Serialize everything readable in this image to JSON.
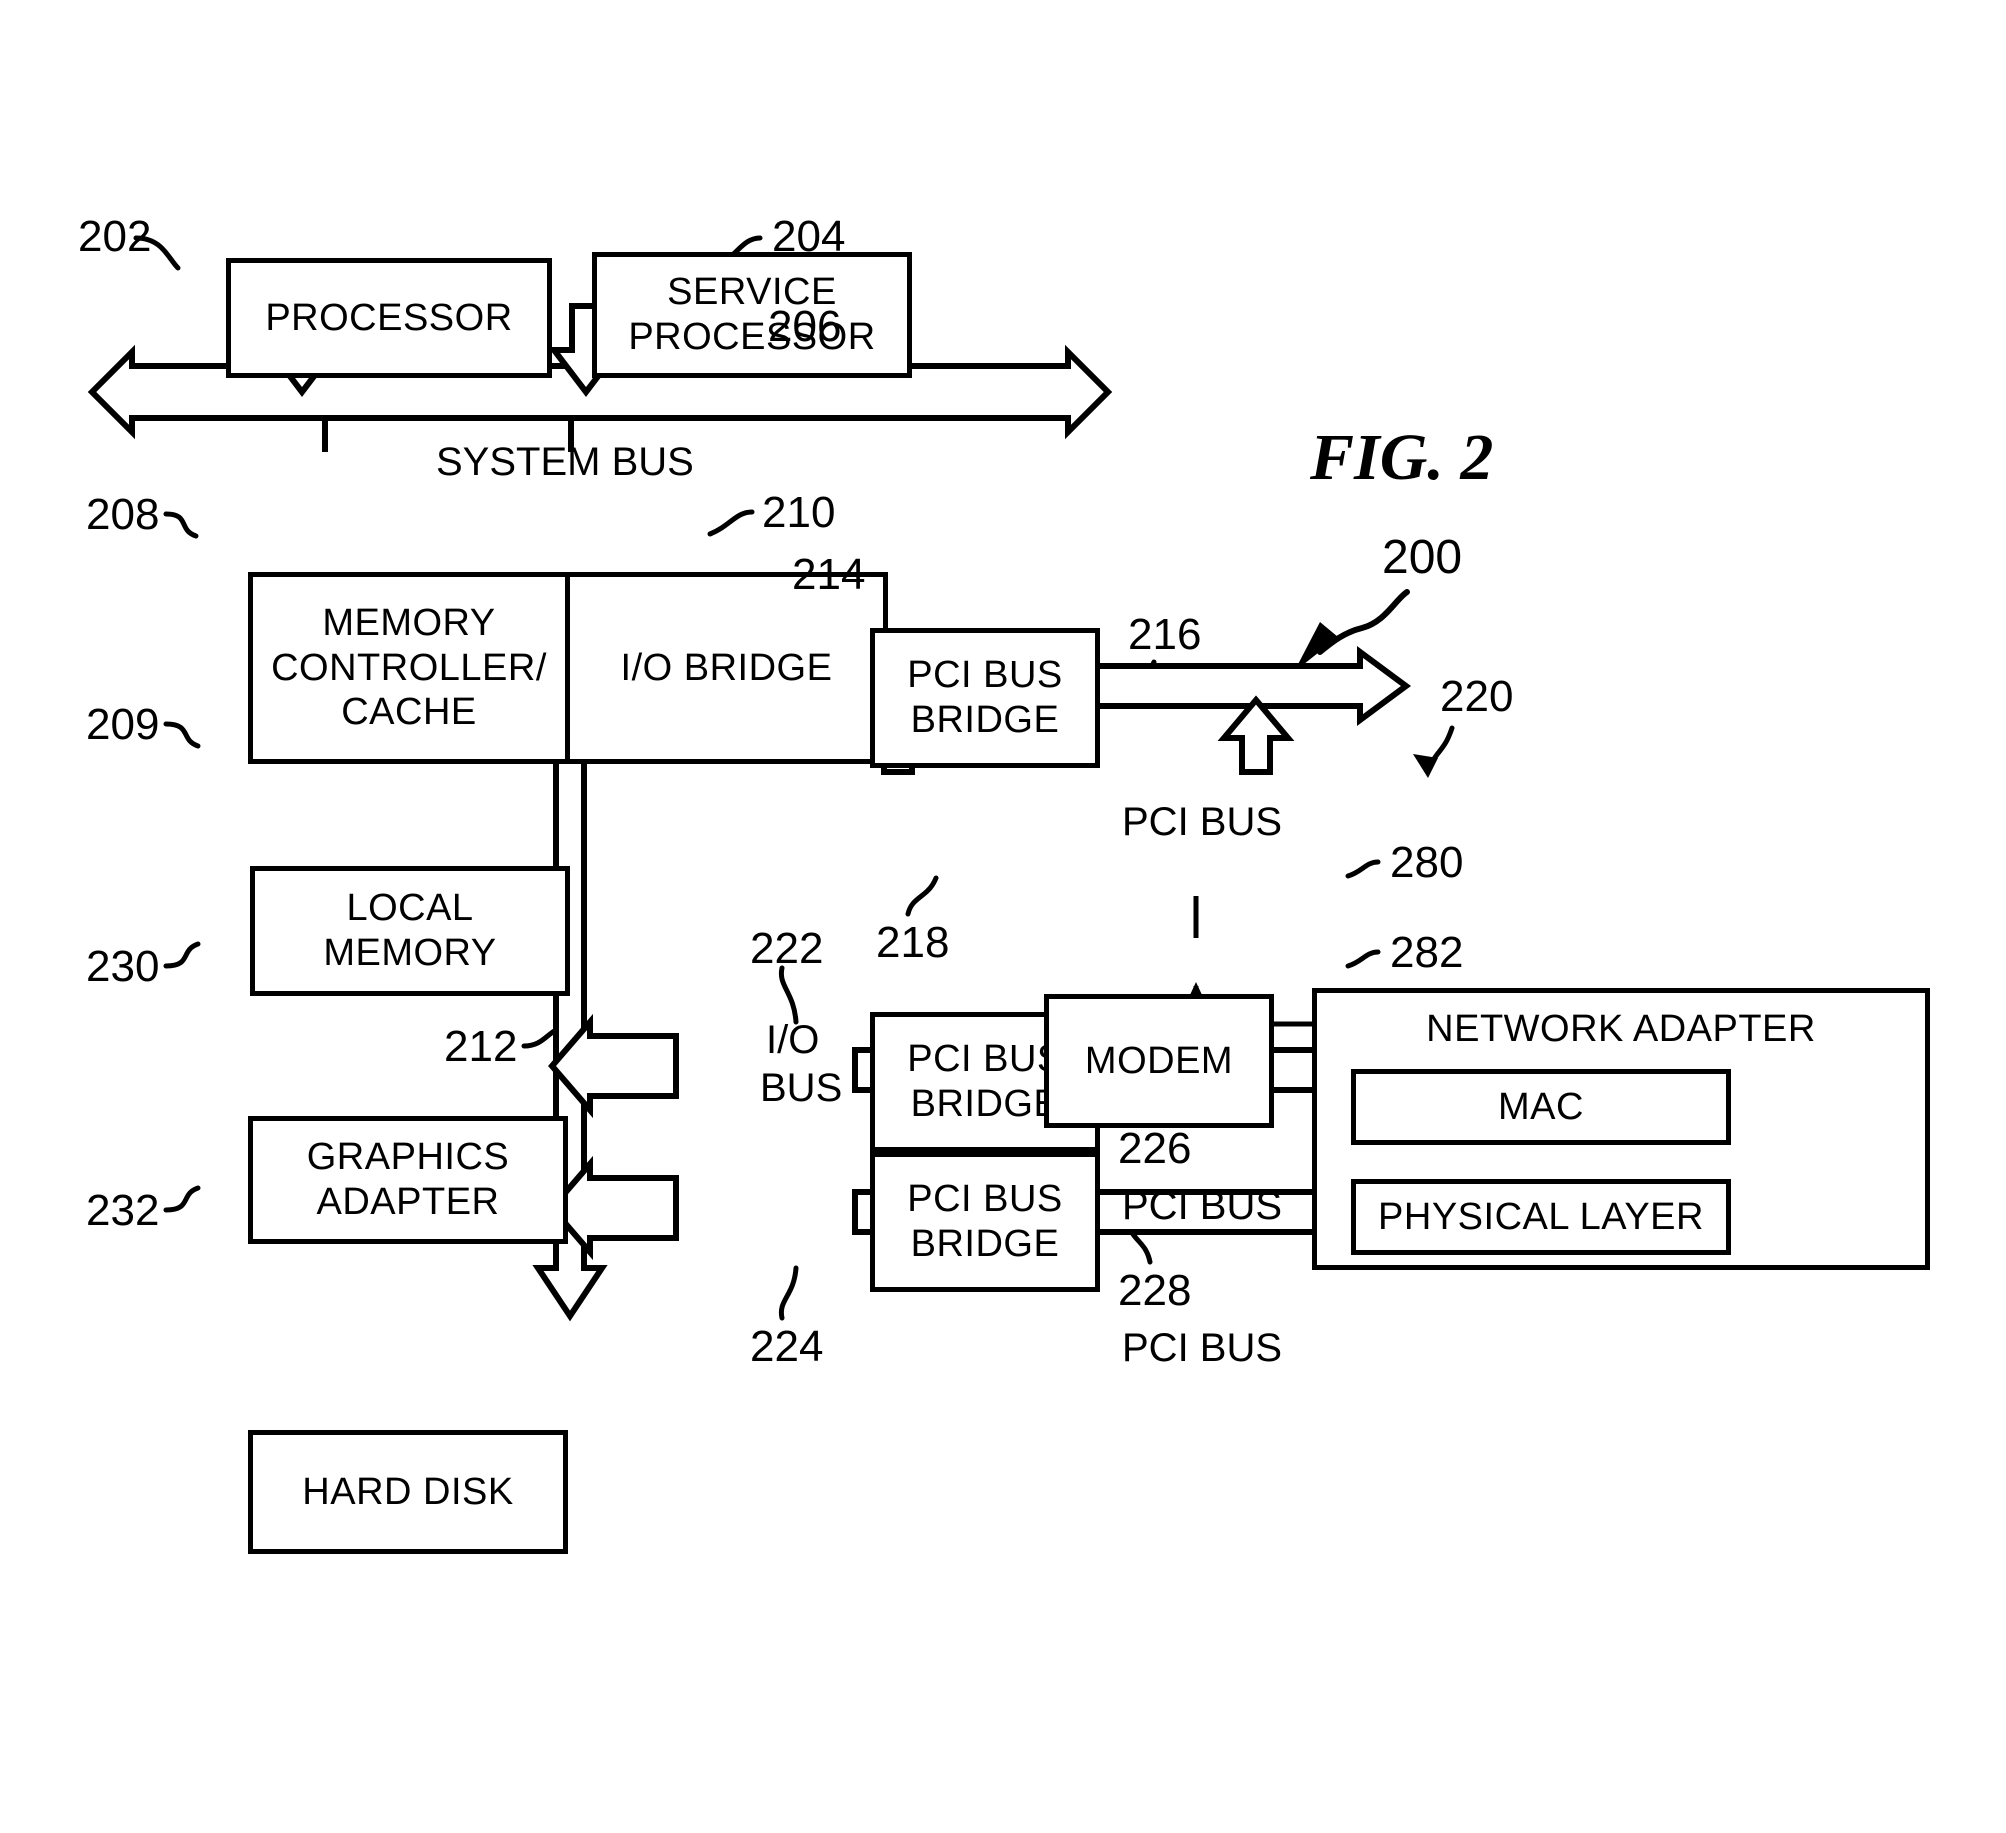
{
  "figure": {
    "title": "FIG. 2",
    "system_ref": "200"
  },
  "blocks": {
    "processor": {
      "label": "PROCESSOR",
      "ref": "202"
    },
    "service_processor": {
      "label": "SERVICE\nPROCESSOR",
      "line1": "SERVICE",
      "line2": "PROCESSOR",
      "ref": "204"
    },
    "memory_controller": {
      "line1": "MEMORY",
      "line2": "CONTROLLER/",
      "line3": "CACHE",
      "ref": "208"
    },
    "io_bridge": {
      "label": "I/O BRIDGE",
      "ref": "210"
    },
    "local_memory": {
      "line1": "LOCAL",
      "line2": "MEMORY",
      "ref": "209"
    },
    "graphics_adapter": {
      "line1": "GRAPHICS",
      "line2": "ADAPTER",
      "ref": "230"
    },
    "hard_disk": {
      "label": "HARD DISK",
      "ref": "232"
    },
    "pci_bus_bridge_1": {
      "line1": "PCI BUS",
      "line2": "BRIDGE",
      "ref": "214"
    },
    "pci_bus_bridge_2": {
      "line1": "PCI BUS",
      "line2": "BRIDGE",
      "ref": "222"
    },
    "pci_bus_bridge_3": {
      "line1": "PCI BUS",
      "line2": "BRIDGE",
      "ref": "224"
    },
    "modem": {
      "label": "MODEM",
      "ref": "218"
    },
    "network_adapter": {
      "label": "NETWORK ADAPTER",
      "ref": "220"
    },
    "mac": {
      "label": "MAC",
      "ref": "280"
    },
    "physical_layer": {
      "label": "PHYSICAL LAYER",
      "ref": "282"
    }
  },
  "buses": {
    "system_bus": {
      "label": "SYSTEM BUS",
      "ref": "206"
    },
    "io_bus": {
      "line1": "I/O",
      "line2": "BUS",
      "ref": "212"
    },
    "pci_bus_1": {
      "label": "PCI BUS",
      "ref": "216"
    },
    "pci_bus_2": {
      "label": "PCI BUS",
      "ref": "226"
    },
    "pci_bus_3": {
      "label": "PCI BUS",
      "ref": "228"
    }
  },
  "colors": {
    "ink": "#000000",
    "paper": "#ffffff"
  }
}
